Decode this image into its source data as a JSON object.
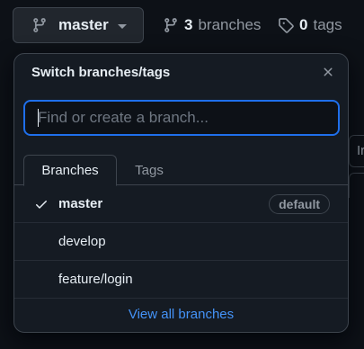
{
  "topbar": {
    "branch_button_label": "master",
    "branches_count": "3",
    "branches_label": "branches",
    "tags_count": "0",
    "tags_label": "tags"
  },
  "background": {
    "partial_text": "Ir"
  },
  "popover": {
    "title": "Switch branches/tags",
    "search": {
      "placeholder": "Find or create a branch...",
      "value": ""
    },
    "tabs": [
      {
        "label": "Branches",
        "active": true
      },
      {
        "label": "Tags",
        "active": false
      }
    ],
    "branches": [
      {
        "name": "master",
        "selected": true,
        "badge": "default"
      },
      {
        "name": "develop",
        "selected": false,
        "badge": ""
      },
      {
        "name": "feature/login",
        "selected": false,
        "badge": ""
      }
    ],
    "view_all_label": "View all branches"
  },
  "colors": {
    "background": "#0d1117",
    "popover": "#151b23",
    "accent_link": "#4493f8",
    "focus_border": "#1f6feb"
  },
  "icons": {
    "branch": "git-branch-icon",
    "tag": "tag-icon",
    "close": "close-icon",
    "check": "check-icon",
    "caret": "caret-down-icon"
  }
}
